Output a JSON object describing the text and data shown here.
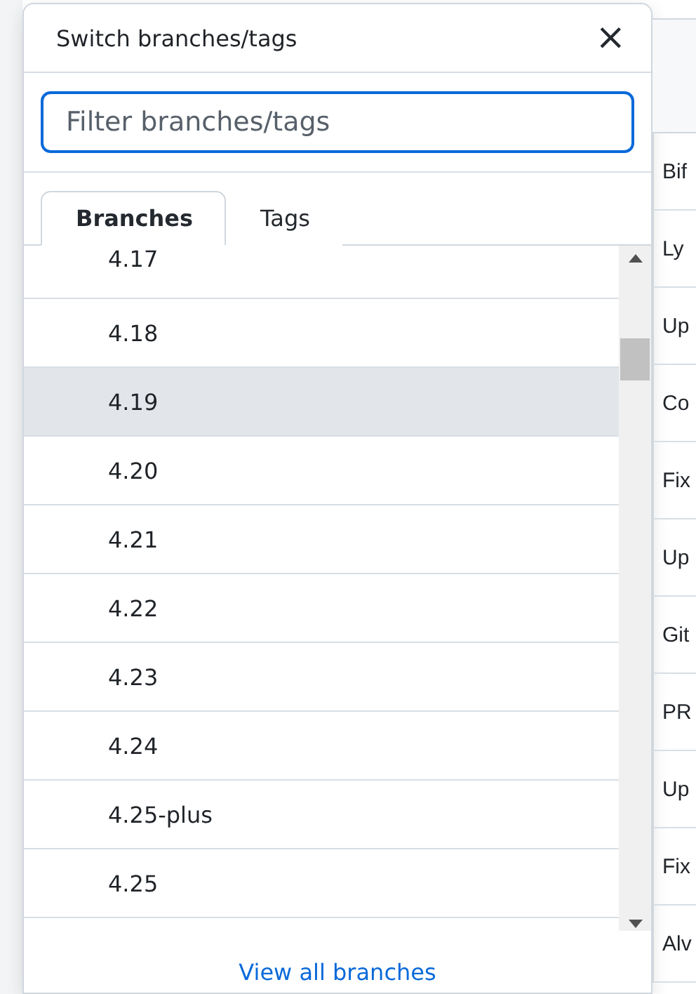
{
  "dialog": {
    "title": "Switch branches/tags",
    "close": "×",
    "filter": {
      "placeholder": "Filter branches/tags"
    },
    "tabs": [
      {
        "label": "Branches",
        "selected": true
      },
      {
        "label": "Tags",
        "selected": false
      }
    ],
    "branches": [
      {
        "name": "4.17",
        "highlighted": false
      },
      {
        "name": "4.18",
        "highlighted": false
      },
      {
        "name": "4.19",
        "highlighted": true
      },
      {
        "name": "4.20",
        "highlighted": false
      },
      {
        "name": "4.21",
        "highlighted": false
      },
      {
        "name": "4.22",
        "highlighted": false
      },
      {
        "name": "4.23",
        "highlighted": false
      },
      {
        "name": "4.24",
        "highlighted": false
      },
      {
        "name": "4.25-plus",
        "highlighted": false
      },
      {
        "name": "4.25",
        "highlighted": false
      }
    ],
    "footer_link": "View all branches"
  },
  "background_rows": [
    "Bif",
    "Ly",
    "Up",
    "Co",
    "Fix",
    "Up",
    "Git",
    "PR",
    "Up",
    "Fix",
    "Alv"
  ]
}
